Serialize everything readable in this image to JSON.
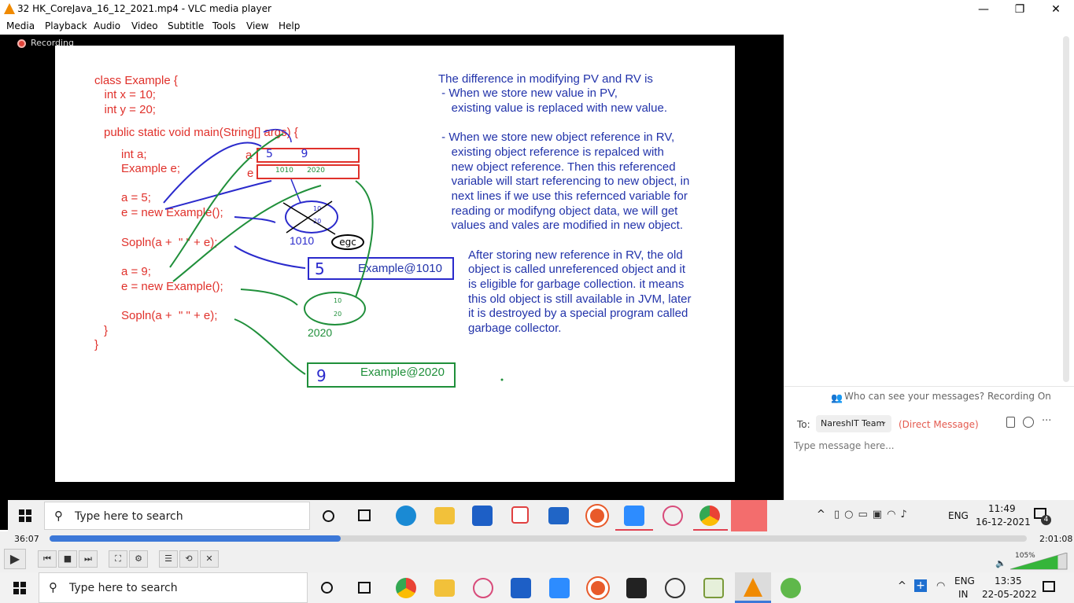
{
  "window": {
    "title": "32 HK_CoreJava_16_12_2021.mp4 - VLC media player",
    "minimize": "—",
    "restore": "❐",
    "close": "✕"
  },
  "menu": [
    "Media",
    "Playback",
    "Audio",
    "Video",
    "Subtitle",
    "Tools",
    "View",
    "Help"
  ],
  "recording_label": "Recording",
  "slide": {
    "code_lines": [
      "class Example {",
      "   int x = 10;",
      "   int y = 20;",
      "public static void main(String[] args) {",
      "int a;",
      "Example e;",
      "a = 5;",
      "e = new Example();",
      "Sopln(a +  \" \" + e);",
      "a = 9;",
      "e = new Example();",
      "Sopln(a +  \" \" + e);",
      "}",
      "}"
    ],
    "note1": [
      "The difference in modifying PV and RV is",
      " - When we store new value in PV,",
      "    existing value is replaced with new value.",
      "",
      " - When we store new object reference in RV,",
      "    existing object reference is repalced with",
      "    new object reference. Then this referenced",
      "    variable will start referencing to new object, in",
      "    next lines if we use this refernced variable for",
      "    reading or modifyng object data, we will get",
      "    values and vales are modified in new object."
    ],
    "note2": [
      "After storing new reference in RV, the old",
      "object is called unreferenced object and it",
      "is eligible for garbage collection. it means",
      "this old object is still available in JVM, later",
      "it is destroyed by a special program called",
      "garbage collector."
    ],
    "var_a_label": "a",
    "var_e_label": "e",
    "a_values": "5        9",
    "e_values": "1010      2020",
    "obj1_addr": "1010",
    "obj2_addr": "2020",
    "egc": "egc",
    "out1_value": "5",
    "out1_text": "Example@1010",
    "out2_value": "9",
    "out2_text": "Example@2020",
    "obj_x_val": "10",
    "obj_y_val": "20"
  },
  "chat": {
    "visibility": "Who can see your messages? Recording On",
    "to_label": "To:",
    "recipient": "NareshIT Team",
    "direct": "(Direct Message)",
    "placeholder": "Type message here..."
  },
  "inner_taskbar": {
    "search_placeholder": "Type here to search",
    "lang": "ENG",
    "time": "11:49",
    "date": "16-12-2021",
    "notif_count": "4"
  },
  "player": {
    "elapsed": "36:07",
    "total": "2:01:08",
    "progress": 0.298,
    "volume_pct": "105%",
    "volume": 1.05
  },
  "outer_taskbar": {
    "search_placeholder": "Type here to search",
    "lang": "ENG",
    "region": "IN",
    "time": "13:35",
    "date": "22-05-2022"
  }
}
